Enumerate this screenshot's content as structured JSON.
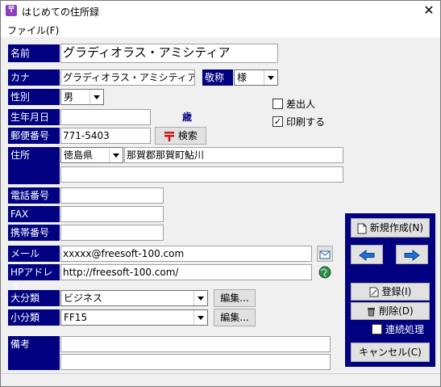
{
  "window": {
    "title": "はじめての住所録",
    "close_glyph": "✕"
  },
  "menu": {
    "file": "ファイル(F)"
  },
  "form": {
    "name": {
      "label": "名前",
      "value": "グラディオラス・アミシティア"
    },
    "kana": {
      "label": "カナ",
      "value": "グラディオラス・アミシティア"
    },
    "honorific": {
      "label": "敬称",
      "value": "様"
    },
    "gender": {
      "label": "性別",
      "value": "男"
    },
    "birthday": {
      "label": "生年月日",
      "value": "",
      "age_unit": "歳"
    },
    "postal": {
      "label": "郵便番号",
      "value": "771-5403",
      "search_label": "検索"
    },
    "address": {
      "label": "住所",
      "prefecture": "徳島県",
      "line1": "那賀郡那賀町鮎川",
      "line2": ""
    },
    "phone": {
      "label": "電話番号",
      "value": ""
    },
    "fax": {
      "label": "FAX",
      "value": ""
    },
    "mobile": {
      "label": "携帯番号",
      "value": ""
    },
    "email": {
      "label": "メール",
      "value": "xxxxx@freesoft-100.com"
    },
    "homepage": {
      "label": "HPアドレス",
      "value": "http://freesoft-100.com/"
    },
    "category_major": {
      "label": "大分類",
      "value": "ビジネス",
      "edit_label": "編集..."
    },
    "category_minor": {
      "label": "小分類",
      "value": "FF15",
      "edit_label": "編集..."
    },
    "notes": {
      "label": "備考",
      "line1": "",
      "line2": ""
    },
    "sender": {
      "label": "差出人",
      "checked": false
    },
    "print": {
      "label": "印刷する",
      "checked": true,
      "check_glyph": "✓"
    }
  },
  "panel": {
    "new_label": "新規作成(N)",
    "prev_glyph": "🡄",
    "next_glyph": "🡆",
    "register_label": "登録(I)",
    "delete_label": "削除(D)",
    "continuous_label": "連続処理",
    "continuous_checked": false,
    "cancel_label": "キャンセル(C)"
  },
  "colors": {
    "label_bg": "#000080",
    "panel_bg": "#000080",
    "arrow": "#1f6fd6"
  }
}
